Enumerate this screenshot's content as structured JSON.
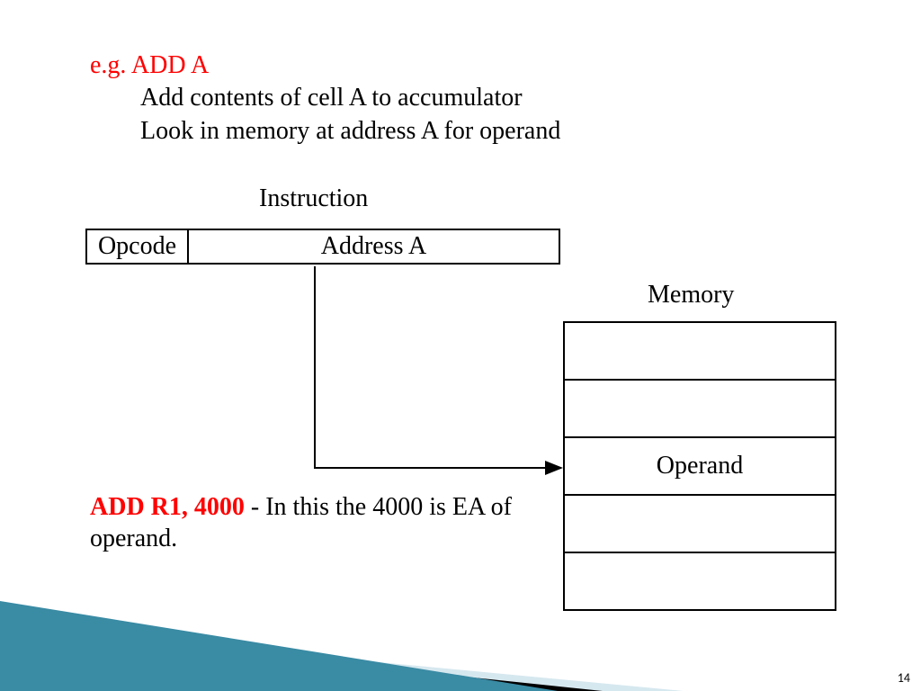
{
  "header": {
    "eg_prefix": "e.g.",
    "eg_cmd": "  ADD A",
    "line2": "Add contents of cell A to accumulator",
    "line3": "Look in memory at address A for operand"
  },
  "instruction": {
    "title": "Instruction",
    "opcode": "Opcode",
    "address": "Address A"
  },
  "memory": {
    "title": "Memory",
    "cells": [
      "",
      "",
      "Operand",
      "",
      ""
    ]
  },
  "bottom": {
    "red": "ADD R1, 4000",
    "rest": " - In this the 4000 is EA of operand."
  },
  "page_number": "14"
}
